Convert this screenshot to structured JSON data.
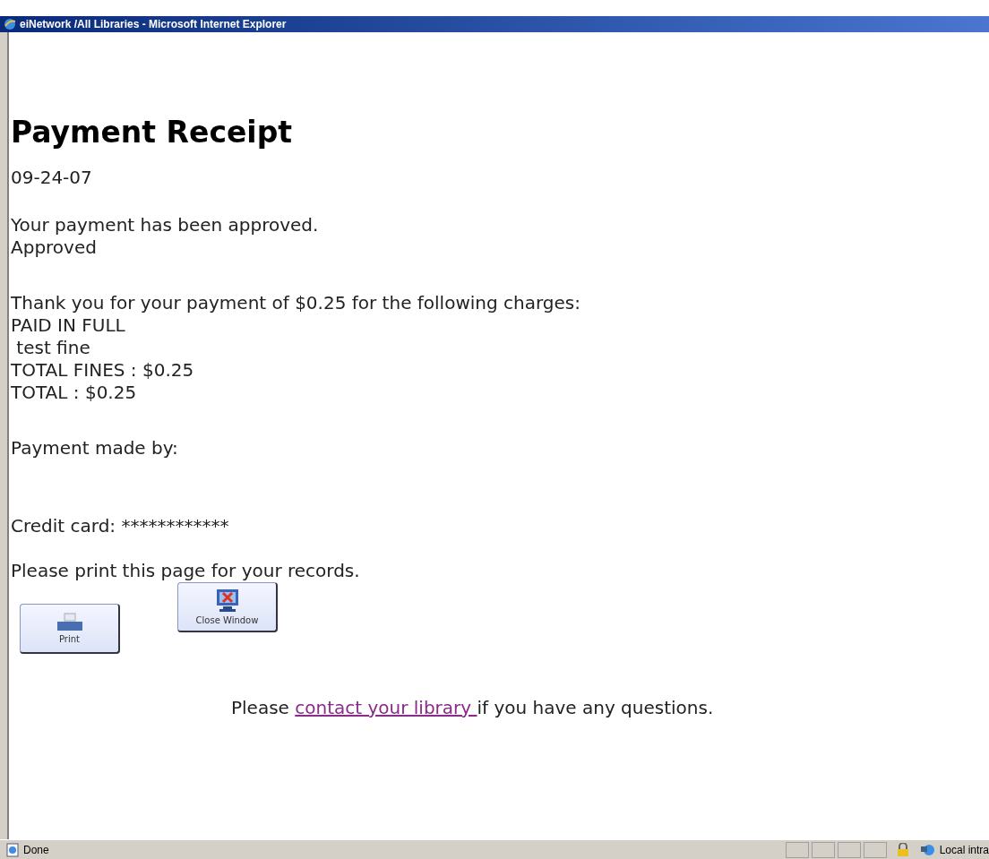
{
  "window": {
    "title": "eiNetwork /All Libraries - Microsoft Internet Explorer"
  },
  "page": {
    "heading": "Payment Receipt",
    "date": "09-24-07",
    "approval": [
      "Your payment has been approved.",
      "Approved"
    ],
    "charges": [
      "Thank you for your payment of $0.25 for the following charges:",
      "PAID IN FULL",
      " test fine",
      "TOTAL FINES : $0.25",
      "TOTAL : $0.25"
    ],
    "payer_label": "Payment made by:",
    "card": "Credit card: ************",
    "print_note": "Please print this page for your records.",
    "buttons": [
      {
        "kind": "print",
        "label": "Print"
      },
      {
        "kind": "close",
        "label": "Close Window"
      }
    ],
    "contact": {
      "before": "Please ",
      "link": "contact your library ",
      "after": "if you have any questions."
    }
  },
  "status_bar": {
    "status": "Done",
    "zone": "Local intra"
  }
}
